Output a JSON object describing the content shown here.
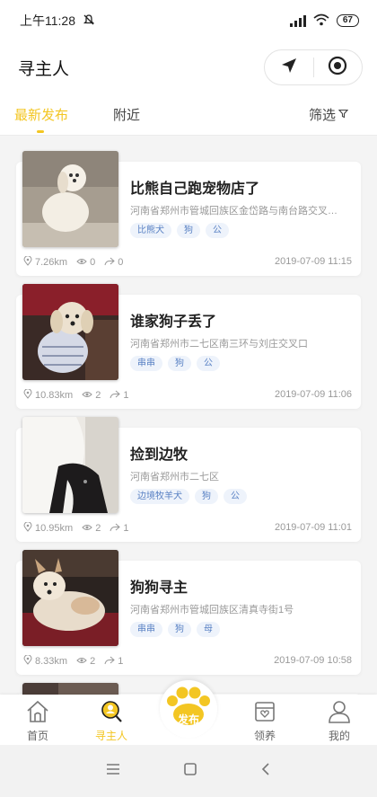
{
  "status_bar": {
    "time": "上午11:28",
    "battery": "67"
  },
  "header": {
    "title": "寻主人"
  },
  "tabs": {
    "latest": "最新发布",
    "nearby": "附近",
    "filter": "筛选"
  },
  "posts": [
    {
      "title": "比熊自己跑宠物店了",
      "address": "河南省郑州市管城回族区金岱路与南台路交叉口...",
      "tags": [
        "比熊犬",
        "狗",
        "公"
      ],
      "distance": "7.26km",
      "views": "0",
      "shares": "0",
      "time": "2019-07-09 11:15"
    },
    {
      "title": "谁家狗子丢了",
      "address": "河南省郑州市二七区南三环与刘庄交叉口",
      "tags": [
        "串串",
        "狗",
        "公"
      ],
      "distance": "10.83km",
      "views": "2",
      "shares": "1",
      "time": "2019-07-09 11:06"
    },
    {
      "title": "捡到边牧",
      "address": "河南省郑州市二七区",
      "tags": [
        "边境牧羊犬",
        "狗",
        "公"
      ],
      "distance": "10.95km",
      "views": "2",
      "shares": "1",
      "time": "2019-07-09 11:01"
    },
    {
      "title": "狗狗寻主",
      "address": "河南省郑州市管城回族区清真寺街1号",
      "tags": [
        "串串",
        "狗",
        "母"
      ],
      "distance": "8.33km",
      "views": "2",
      "shares": "1",
      "time": "2019-07-09 10:58"
    }
  ],
  "bottom_nav": {
    "home": "首页",
    "find": "寻主人",
    "publish": "发布",
    "adopt": "领养",
    "mine": "我的"
  },
  "colors": {
    "accent": "#f3c623",
    "tag_text": "#5a82c4",
    "tag_bg": "#eef3fb"
  },
  "icons": [
    "mute-icon",
    "signal-icon",
    "wifi-icon",
    "location-arrow-icon",
    "target-icon",
    "filter-icon",
    "location-pin-icon",
    "eye-icon",
    "share-icon",
    "home-icon",
    "search-person-icon",
    "paw-icon",
    "adopt-box-icon",
    "user-icon",
    "menu-icon",
    "square-icon",
    "back-icon"
  ]
}
